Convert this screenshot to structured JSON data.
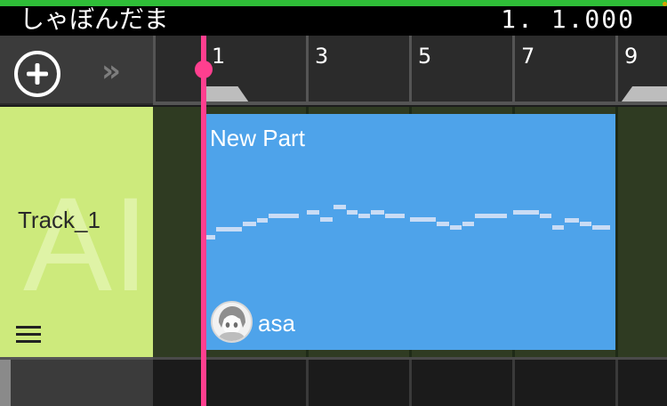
{
  "header": {
    "song_title": "しゃぼんだま",
    "position": "1. 1.000"
  },
  "controls": {
    "add_track_icon": "plus-circle-icon",
    "expand_icon": "double-chevron-right-icon"
  },
  "ruler": {
    "measures": [
      "1",
      "3",
      "5",
      "7",
      "9"
    ]
  },
  "track": {
    "name": "Track_1",
    "watermark": "AI",
    "menu_icon": "hamburger-menu-icon"
  },
  "part": {
    "label": "New Part",
    "singer": "asa"
  },
  "colors": {
    "accent_bar": "#2fbe38",
    "playhead": "#ff3f8f",
    "part": "#4ea3ea",
    "track_head": "#cdea7c"
  }
}
